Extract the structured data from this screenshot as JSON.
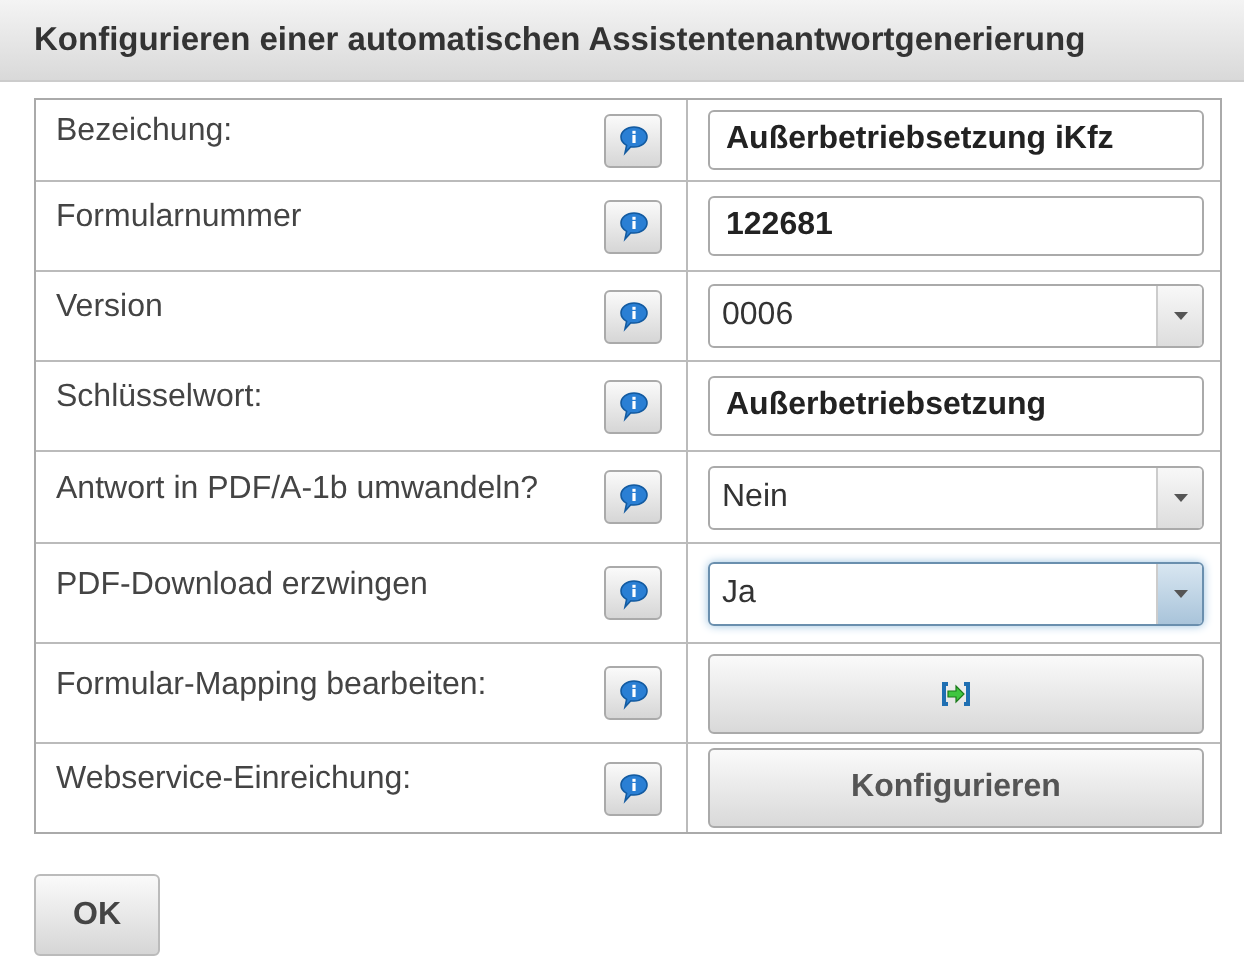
{
  "window": {
    "title": "Konfigurieren einer automatischen Assistentenantwortgenerierung"
  },
  "rows": [
    {
      "label": "Bezeichung:",
      "kind": "text",
      "value": "Außerbetriebsetzung iKfz"
    },
    {
      "label": "Formularnummer",
      "kind": "text",
      "value": "122681"
    },
    {
      "label": "Version",
      "kind": "select",
      "value": "0006",
      "focused": false
    },
    {
      "label": "Schlüsselwort:",
      "kind": "text",
      "value": "Außerbetriebsetzung"
    },
    {
      "label": "Antwort in PDF/A-1b umwandeln?",
      "kind": "select",
      "value": "Nein",
      "focused": false
    },
    {
      "label": "PDF-Download erzwingen",
      "kind": "select",
      "value": "Ja",
      "focused": true
    },
    {
      "label": "Formular-Mapping bearbeiten:",
      "kind": "icon-button"
    },
    {
      "label": "Webservice-Einreichung:",
      "kind": "button",
      "text": "Konfigurieren"
    }
  ],
  "buttons": [
    "OK"
  ]
}
